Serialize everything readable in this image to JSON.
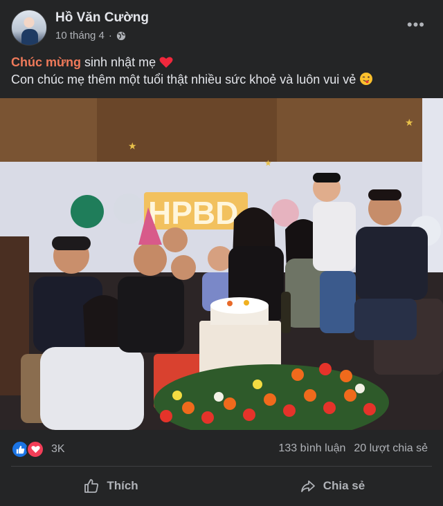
{
  "post": {
    "author": "Hồ Văn Cường",
    "date": "10 tháng 4",
    "caption_highlight": "Chúc mừng",
    "caption_line1_rest": " sinh nhật mẹ",
    "caption_line2": "Con chúc mẹ thêm một tuổi thật nhiều sức khoẻ và luôn vui vẻ",
    "photo": {
      "balloon_letters": "HPBD"
    }
  },
  "reactions": {
    "count": "3K",
    "icons": [
      "like-icon",
      "love-icon"
    ]
  },
  "stats": {
    "comments": "133 bình luận",
    "shares": "20 lượt chia sẻ"
  },
  "actions": {
    "like_label": "Thích",
    "share_label": "Chia sẻ"
  },
  "colors": {
    "background": "#242526",
    "highlight": "#f07a5a",
    "like_blue": "#1b74e4",
    "love_red": "#f33e58"
  }
}
